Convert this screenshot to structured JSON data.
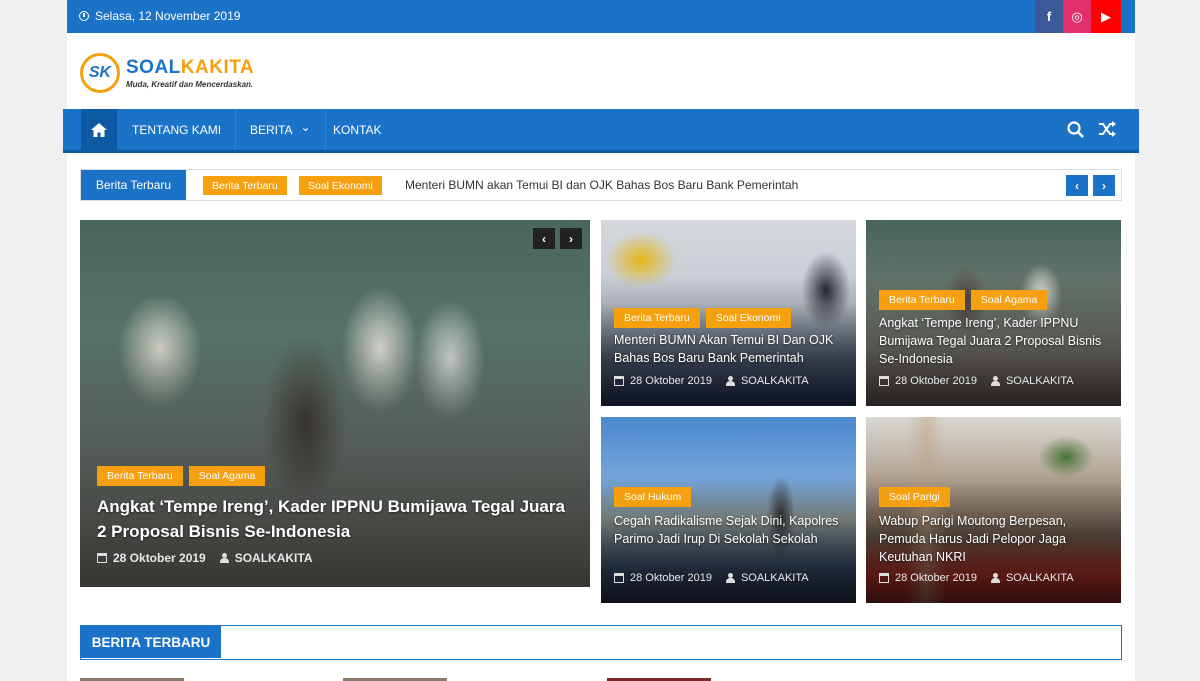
{
  "topbar": {
    "date": "Selasa, 12 November 2019",
    "social": [
      {
        "icon": "facebook-icon",
        "glyph": "f"
      },
      {
        "icon": "instagram-icon",
        "glyph": "◎"
      },
      {
        "icon": "youtube-icon",
        "glyph": "▶"
      }
    ]
  },
  "header": {
    "logo_mark": "SK",
    "logo_name_1": "SOAL",
    "logo_name_2": "KAKITA",
    "tagline": "Muda, Kreatif dan Mencerdaskan."
  },
  "nav": {
    "home_icon": "home-icon",
    "items": [
      "TENTANG KAMI",
      "BERITA",
      "KONTAK"
    ],
    "berita_caret": "⌄",
    "search_icon": "search-icon",
    "random_icon": "shuffle-icon"
  },
  "ticker": {
    "label": "Berita Terbaru",
    "badges": [
      "Berita Terbaru",
      "Soal Ekonomi"
    ],
    "headline": "Menteri BUMN akan Temui BI dan OJK Bahas Bos Baru Bank Pemerintah",
    "prev": "‹",
    "next": "›"
  },
  "featured": {
    "prev": "‹",
    "next": "›",
    "cats": [
      "Berita Terbaru",
      "Soal Agama"
    ],
    "title": "Angkat ‘Tempe Ireng’, Kader IPPNU Bumijawa Tegal Juara 2 Proposal Bisnis Se-Indonesia",
    "date": "28 Oktober 2019",
    "author": "SOALKAKITA"
  },
  "cards": [
    {
      "cats": [
        "Berita Terbaru",
        "Soal Ekonomi"
      ],
      "title": "Menteri BUMN Akan Temui BI Dan OJK Bahas Bos Baru Bank Pemerintah",
      "date": "28 Oktober 2019",
      "author": "SOALKAKITA"
    },
    {
      "cats": [
        "Berita Terbaru",
        "Soal Agama"
      ],
      "title": "Angkat ‘Tempe Ireng’, Kader IPPNU Bumijawa Tegal Juara 2 Proposal Bisnis Se-Indonesia",
      "date": "28 Oktober 2019",
      "author": "SOALKAKITA"
    },
    {
      "cats": [
        "Soal Hukum"
      ],
      "title": "Cegah Radikalisme Sejak Dini, Kapolres Parimo Jadi Irup Di Sekolah Sekolah",
      "date": "28 Oktober 2019",
      "author": "SOALKAKITA"
    },
    {
      "cats": [
        "Soal Parigi"
      ],
      "title": "Wabup Parigi Moutong Berpesan, Pemuda Harus Jadi Pelopor Jaga Keutuhan NKRI",
      "date": "28 Oktober 2019",
      "author": "SOALKAKITA"
    }
  ],
  "section": {
    "label": "BERITA TERBARU"
  },
  "colors": {
    "primary": "#1a73c7",
    "accent": "#f5a00f"
  }
}
